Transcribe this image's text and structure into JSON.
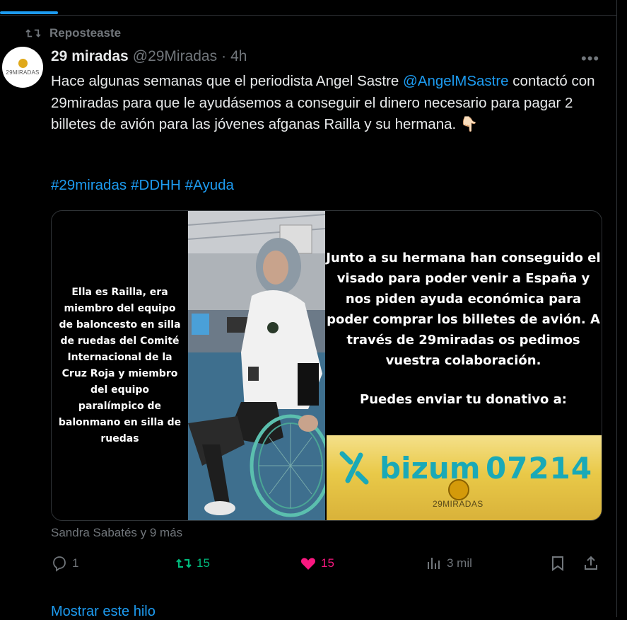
{
  "repost": {
    "label": "Reposteaste",
    "icon": "repost-icon"
  },
  "author": {
    "name": "29 miradas",
    "handle": "@29Miradas",
    "time": "4h",
    "avatar_text": "29MIRADAS"
  },
  "tweet": {
    "text_before_mention": "Hace algunas semanas que el periodista Angel Sastre ",
    "mention": "@AngelMSastre",
    "text_after_mention": " contactó con 29miradas para que le ayudásemos a conseguir el dinero necesario para pagar 2 billetes de avión para las jóvenes afganas Railla y su hermana. ",
    "emoji": "👇🏻",
    "hashtags": [
      "#29miradas",
      "#DDHH",
      "#Ayuda"
    ]
  },
  "media": {
    "left_text": "Ella es Railla, era miembro del equipo de baloncesto en silla de ruedas del Comité Internacional de la Cruz Roja y miembro del equipo paralímpico de balonmano en silla de ruedas",
    "right_text": "Junto a su hermana han conseguido el visado para poder venir a España y nos piden ayuda económica para poder comprar los billetes de avión. A través de 29miradas os pedimos vuestra colaboración.",
    "donate_text": "Puedes enviar tu donativo a:",
    "bizum_word": "bizum",
    "bizum_code": "07214",
    "brand_text": "29MIRADAS"
  },
  "liked_by": "Sandra Sabatés y 9 más",
  "actions": {
    "reply_count": "1",
    "retweet_count": "15",
    "like_count": "15",
    "views_count": "3 mil"
  },
  "show_thread": "Mostrar este hilo",
  "colors": {
    "accent": "#1d9bf0",
    "retweet": "#00ba7c",
    "like": "#f91880",
    "muted": "#71767b",
    "bizum": "#1aa9b7"
  }
}
